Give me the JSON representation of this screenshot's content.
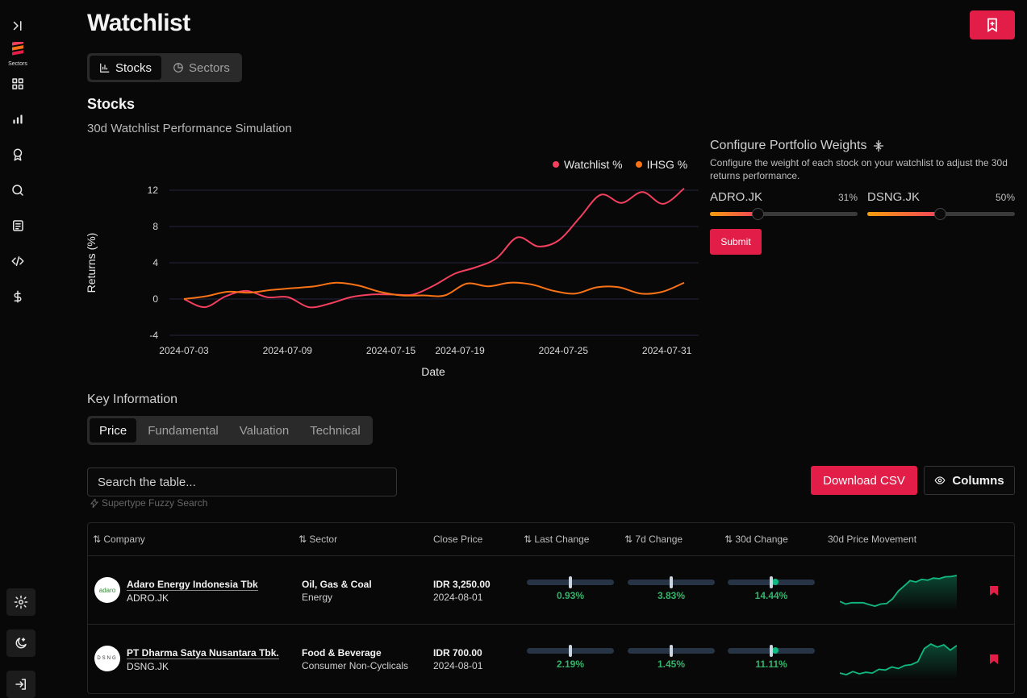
{
  "page": {
    "title": "Watchlist"
  },
  "sidebar": {
    "logo_label": "Sectors",
    "icons": [
      "collapse-icon",
      "grid-icon",
      "bar-chart-icon",
      "award-icon",
      "search-icon",
      "news-icon",
      "code-icon",
      "dollar-icon",
      "settings-icon",
      "theme-icon",
      "login-icon"
    ]
  },
  "tabs": [
    {
      "label": "Stocks",
      "icon": "chart-icon",
      "active": true
    },
    {
      "label": "Sectors",
      "icon": "pie-icon",
      "active": false
    }
  ],
  "section": {
    "title": "Stocks"
  },
  "chart_data": {
    "type": "line",
    "title": "30d Watchlist Performance Simulation",
    "xlabel": "Date",
    "ylabel": "Returns (%)",
    "ylim": [
      -4,
      12
    ],
    "yticks": [
      "12",
      "8",
      "4",
      "0",
      "-4"
    ],
    "xticks": [
      "2024-07-03",
      "2024-07-09",
      "2024-07-15",
      "2024-07-19",
      "2024-07-25",
      "2024-07-31"
    ],
    "x": [
      "2024-07-03",
      "2024-07-04",
      "2024-07-05",
      "2024-07-06",
      "2024-07-07",
      "2024-07-08",
      "2024-07-09",
      "2024-07-10",
      "2024-07-11",
      "2024-07-12",
      "2024-07-13",
      "2024-07-14",
      "2024-07-15",
      "2024-07-16",
      "2024-07-17",
      "2024-07-18",
      "2024-07-19",
      "2024-07-20",
      "2024-07-21",
      "2024-07-22",
      "2024-07-23",
      "2024-07-24",
      "2024-07-25",
      "2024-07-26",
      "2024-07-27",
      "2024-07-28",
      "2024-07-29",
      "2024-07-30",
      "2024-07-31",
      "2024-08-01"
    ],
    "series": [
      {
        "name": "Watchlist %",
        "color": "#f43f5e",
        "values": [
          0,
          -0.9,
          0.3,
          0.9,
          0.2,
          0.2,
          -0.9,
          -0.5,
          0.2,
          0.5,
          0.5,
          0.5,
          1.5,
          2.8,
          3.5,
          4.5,
          6.8,
          6.0,
          5.8,
          6.5,
          9.0,
          11.5,
          10.6,
          11.0,
          11.8,
          10.5,
          10.6,
          11.6,
          12.2,
          12.2
        ],
        "display": [
          0,
          -0.9,
          0.3,
          0.9,
          0.2,
          0.2,
          -0.9,
          -0.5,
          0.2,
          0.5,
          0.5,
          0.5,
          1.5,
          2.8,
          3.5,
          4.5,
          6.8,
          5.8,
          6.5,
          9.0,
          11.5,
          10.6,
          11.8,
          10.5,
          12.2
        ]
      },
      {
        "name": "IHSG %",
        "color": "#f97316",
        "values": [
          0,
          0.3,
          0.8,
          0.7,
          1.0,
          1.2,
          1.4,
          1.8,
          1.5,
          0.8,
          0.4,
          0.4,
          0.4,
          1.7,
          1.4,
          1.8,
          1.6,
          0.9,
          0.6,
          1.3,
          1.3,
          0.6,
          0.8,
          1.8
        ]
      }
    ]
  },
  "weights": {
    "title": "Configure Portfolio Weights",
    "description": "Configure the weight of each stock on your watchlist to adjust the 30d returns performance.",
    "sliders": [
      {
        "ticker": "ADRO.JK",
        "value_label": "31%",
        "value": 0.31
      },
      {
        "ticker": "DSNG.JK",
        "value_label": "50%",
        "value": 0.5
      }
    ],
    "submit_label": "Submit"
  },
  "key_info": {
    "title": "Key Information",
    "tabs": [
      {
        "label": "Price",
        "active": true
      },
      {
        "label": "Fundamental",
        "active": false
      },
      {
        "label": "Valuation",
        "active": false
      },
      {
        "label": "Technical",
        "active": false
      }
    ]
  },
  "table_controls": {
    "search_placeholder": "Search the table...",
    "search_hint": "Supertype Fuzzy Search",
    "download_label": "Download CSV",
    "columns_label": "Columns"
  },
  "table": {
    "headers": [
      "Company",
      "Sector",
      "Close Price",
      "Last Change",
      "7d Change",
      "30d Change",
      "30d Price Movement"
    ],
    "rows": [
      {
        "company": "Adaro Energy Indonesia Tbk",
        "ticker": "ADRO.JK",
        "avatar": "adaro",
        "sector": "Oil, Gas & Coal",
        "subsector": "Energy",
        "close_price": "IDR 3,250.00",
        "date": "2024-08-01",
        "last_change": "0.93%",
        "d7_change": "3.83%",
        "d30_change": "14.44%",
        "last_change_value": 0.93,
        "d7_change_value": 3.83,
        "d30_change_value": 14.44,
        "spark": [
          3280,
          3270,
          3275,
          3275,
          3275,
          3268,
          3262,
          3270,
          3272,
          3290,
          3320,
          3340,
          3360,
          3355,
          3365,
          3362,
          3370,
          3368,
          3375,
          3376,
          3380
        ]
      },
      {
        "company": "PT Dharma Satya Nusantara Tbk.",
        "ticker": "DSNG.JK",
        "avatar": "dsng",
        "sector": "Food & Beverage",
        "subsector": "Consumer Non-Cyclicals",
        "close_price": "IDR 700.00",
        "date": "2024-08-01",
        "last_change": "2.19%",
        "d7_change": "1.45%",
        "d30_change": "11.11%",
        "last_change_value": 2.19,
        "d7_change_value": 1.45,
        "d30_change_value": 11.11,
        "spark": [
          630,
          628,
          632,
          629,
          631,
          630,
          635,
          634,
          638,
          636,
          640,
          641,
          645,
          662,
          668,
          664,
          667,
          660,
          666
        ]
      }
    ]
  }
}
